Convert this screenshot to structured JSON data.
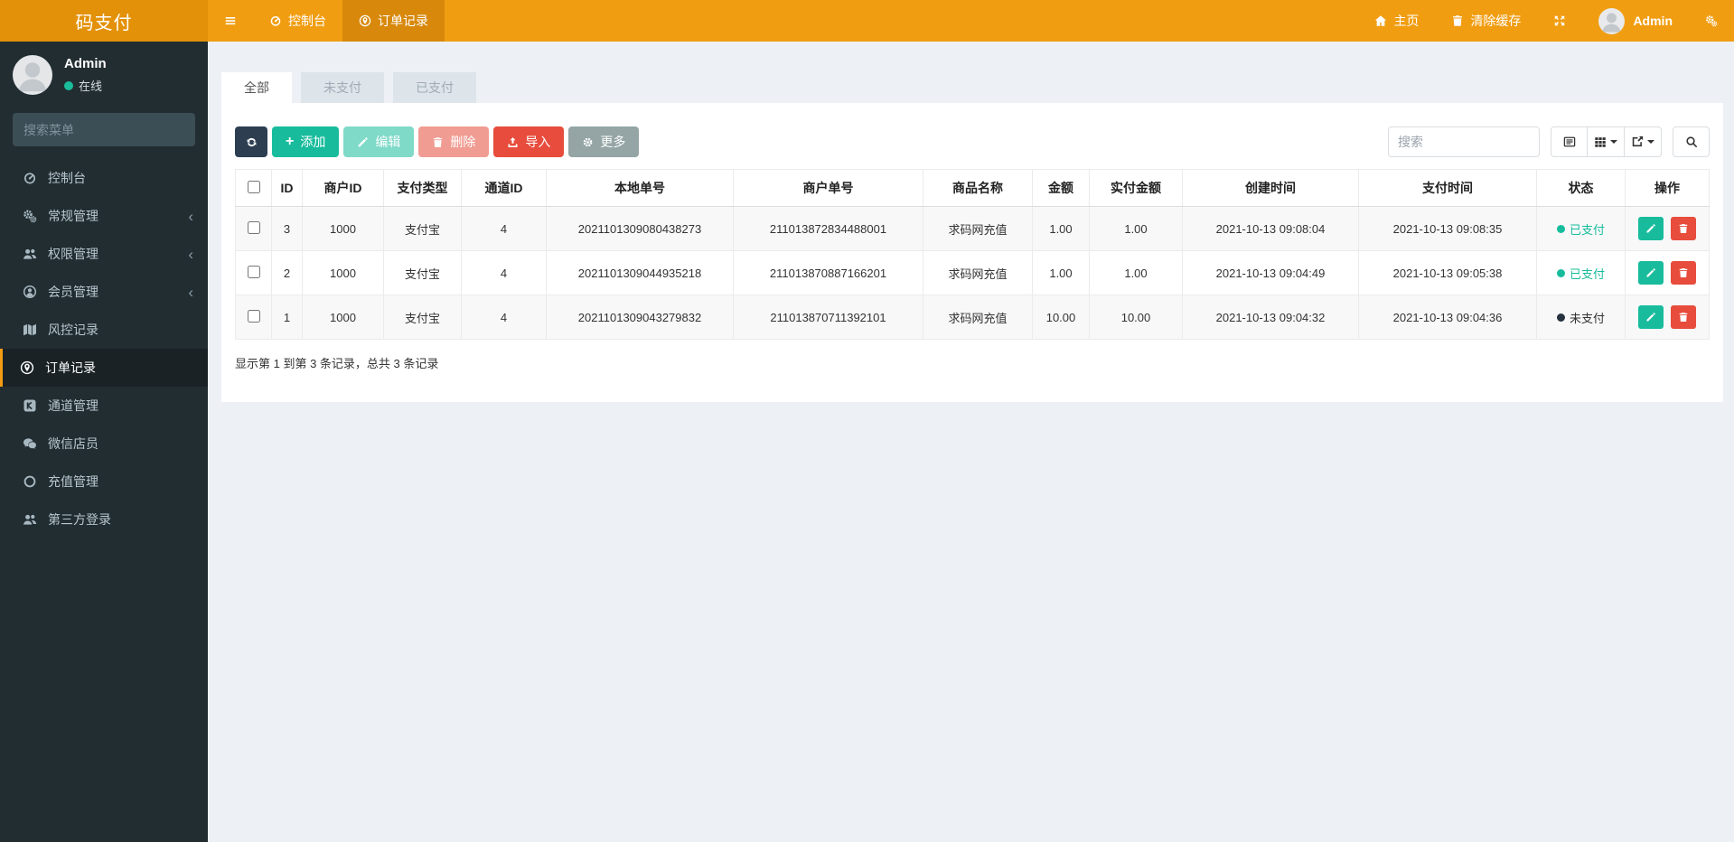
{
  "topbar": {
    "brand": "码支付",
    "console": "控制台",
    "orders": "订单记录",
    "home": "主页",
    "clear_cache": "清除缓存",
    "admin": "Admin",
    "accent_color": "#f39c12"
  },
  "sidebar": {
    "user": {
      "name": "Admin",
      "status": "在线"
    },
    "search_placeholder": "搜索菜单",
    "items": [
      {
        "label": "控制台",
        "icon": "gauge-icon"
      },
      {
        "label": "常规管理",
        "icon": "cogs-icon",
        "chevron": true
      },
      {
        "label": "权限管理",
        "icon": "users-icon",
        "chevron": true
      },
      {
        "label": "会员管理",
        "icon": "user-circle-icon",
        "chevron": true
      },
      {
        "label": "风控记录",
        "icon": "map-icon"
      },
      {
        "label": "订单记录",
        "icon": "pin-circle-icon",
        "active": true
      },
      {
        "label": "通道管理",
        "icon": "channel-icon"
      },
      {
        "label": "微信店员",
        "icon": "wechat-icon"
      },
      {
        "label": "充值管理",
        "icon": "circle-o-icon"
      },
      {
        "label": "第三方登录",
        "icon": "users-icon"
      }
    ]
  },
  "tabs": [
    {
      "label": "全部",
      "active": true
    },
    {
      "label": "未支付",
      "active": false
    },
    {
      "label": "已支付",
      "active": false
    }
  ],
  "toolbar": {
    "add": "添加",
    "edit": "编辑",
    "delete": "删除",
    "import": "导入",
    "more": "更多",
    "search_placeholder": "搜索"
  },
  "table": {
    "columns": [
      "ID",
      "商户ID",
      "支付类型",
      "通道ID",
      "本地单号",
      "商户单号",
      "商品名称",
      "金额",
      "实付金额",
      "创建时间",
      "支付时间",
      "状态",
      "操作"
    ],
    "rows": [
      {
        "id": "3",
        "merchant_id": "1000",
        "pay_type": "支付宝",
        "channel_id": "4",
        "local_no": "2021101309080438273",
        "merchant_no": "211013872834488001",
        "product": "求码网充值",
        "amount": "1.00",
        "paid_amount": "1.00",
        "created": "2021-10-13 09:08:04",
        "paid_time": "2021-10-13 09:08:35",
        "status": "已支付",
        "status_key": "paid"
      },
      {
        "id": "2",
        "merchant_id": "1000",
        "pay_type": "支付宝",
        "channel_id": "4",
        "local_no": "2021101309044935218",
        "merchant_no": "211013870887166201",
        "product": "求码网充值",
        "amount": "1.00",
        "paid_amount": "1.00",
        "created": "2021-10-13 09:04:49",
        "paid_time": "2021-10-13 09:05:38",
        "status": "已支付",
        "status_key": "paid"
      },
      {
        "id": "1",
        "merchant_id": "1000",
        "pay_type": "支付宝",
        "channel_id": "4",
        "local_no": "2021101309043279832",
        "merchant_no": "211013870711392101",
        "product": "求码网充值",
        "amount": "10.00",
        "paid_amount": "10.00",
        "created": "2021-10-13 09:04:32",
        "paid_time": "2021-10-13 09:04:36",
        "status": "未支付",
        "status_key": "unpaid"
      }
    ],
    "summary": "显示第 1 到第 3 条记录，总共 3 条记录"
  },
  "colors": {
    "green": "#18bc9c",
    "red": "#e74c3c",
    "dark": "#2c3e50",
    "gray": "#95a5a6",
    "sidebar": "#222d32",
    "topbar": "#f19d11"
  }
}
